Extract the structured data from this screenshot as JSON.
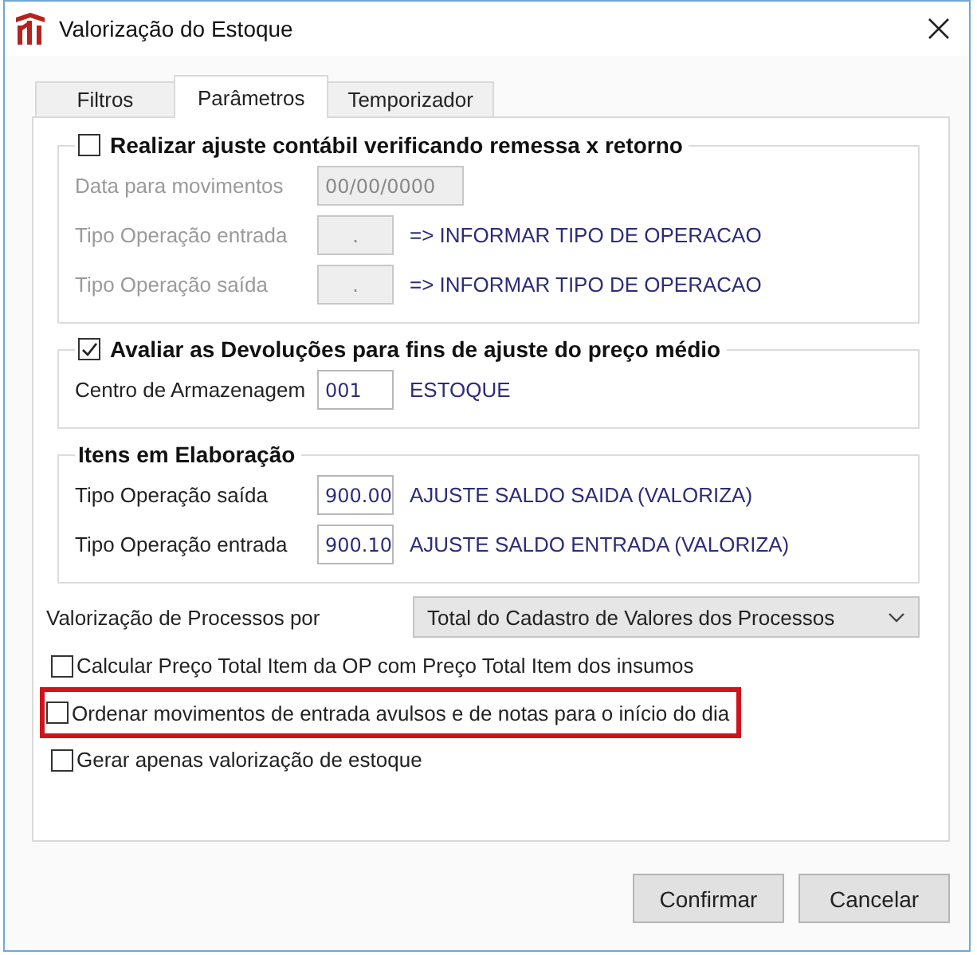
{
  "window": {
    "title": "Valorização do Estoque"
  },
  "tabs": [
    {
      "label": "Filtros",
      "selected": false
    },
    {
      "label": "Parâmetros",
      "selected": true
    },
    {
      "label": "Temporizador",
      "selected": false
    }
  ],
  "groups": [
    {
      "kind": "check",
      "title": "Realizar ajuste contábil verificando remessa x retorno",
      "checked": false,
      "rows": [
        {
          "label": "Data para movimentos",
          "value": "00/00/0000",
          "disabled": true,
          "wide": true
        },
        {
          "label": "Tipo Operação entrada",
          "value": ".",
          "description": "=> INFORMAR TIPO DE OPERACAO",
          "disabled": true
        },
        {
          "label": "Tipo Operação saída",
          "value": ".",
          "description": "=> INFORMAR TIPO DE OPERACAO",
          "disabled": true
        }
      ]
    },
    {
      "kind": "check",
      "title": "Avaliar as Devoluções para fins de ajuste do preço médio",
      "checked": true,
      "rows": [
        {
          "label": "Centro de Armazenagem",
          "value": "001",
          "description": "ESTOQUE",
          "disabled": false
        }
      ]
    },
    {
      "kind": "plain",
      "title": "Itens em Elaboração",
      "rows": [
        {
          "label": "Tipo Operação saída",
          "value": "900.00",
          "description": "AJUSTE SALDO SAIDA (VALORIZA)",
          "disabled": false
        },
        {
          "label": "Tipo Operação entrada",
          "value": "900.10",
          "description": "AJUSTE SALDO ENTRADA (VALORIZA)",
          "disabled": false
        }
      ]
    }
  ],
  "process_valuation": {
    "label": "Valorização de Processos por",
    "value": "Total do Cadastro de Valores dos Processos"
  },
  "options": [
    {
      "label": "Calcular Preço Total Item da OP com Preço Total Item dos insumos",
      "checked": false,
      "highlighted": false
    },
    {
      "label": "Ordenar movimentos de entrada avulsos e de notas para o início do dia",
      "checked": false,
      "highlighted": true
    },
    {
      "label": "Gerar apenas valorização de estoque",
      "checked": false,
      "highlighted": false
    }
  ],
  "buttons": [
    {
      "label": "Confirmar"
    },
    {
      "label": "Cancelar"
    }
  ]
}
